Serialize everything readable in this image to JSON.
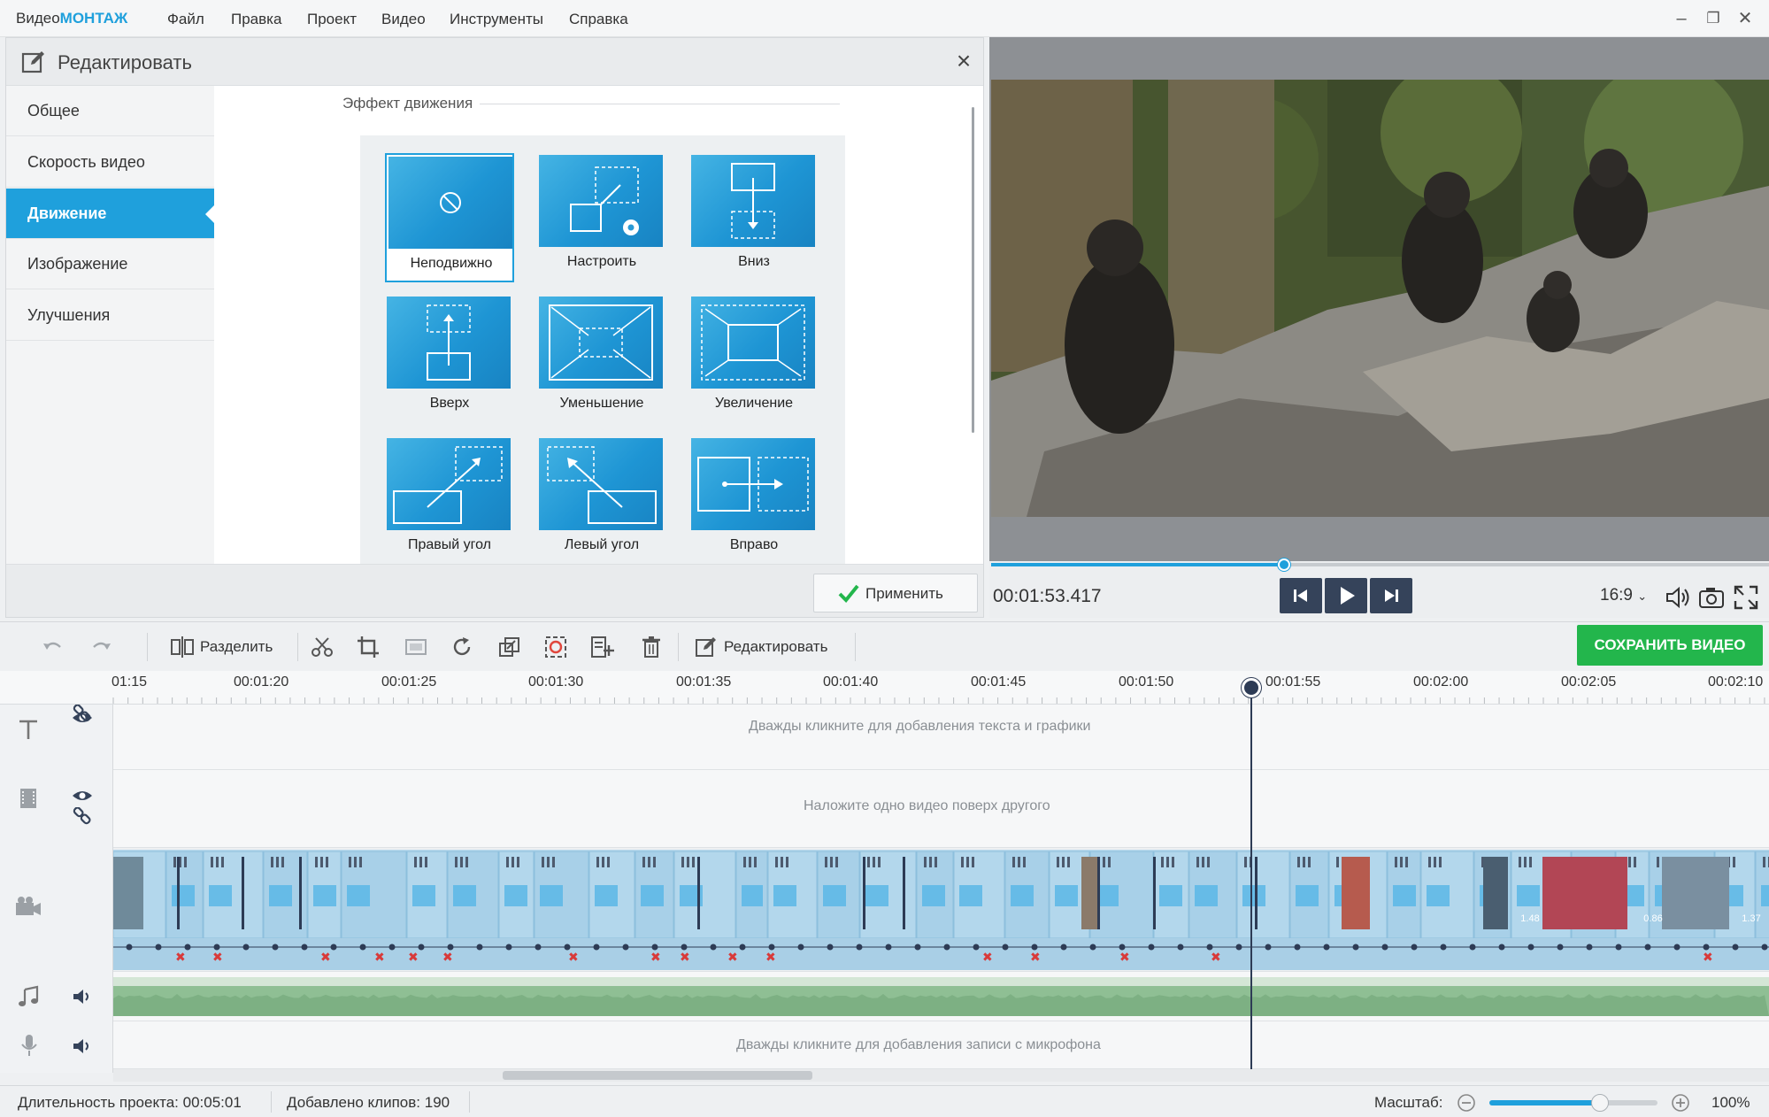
{
  "app": {
    "title_prefix": "Видео",
    "title_accent": "МОНТАЖ"
  },
  "menu": [
    "Файл",
    "Правка",
    "Проект",
    "Видео",
    "Инструменты",
    "Справка"
  ],
  "edit_panel": {
    "title": "Редактировать",
    "nav": [
      "Общее",
      "Скорость видео",
      "Движение",
      "Изображение",
      "Улучшения"
    ],
    "active_nav": "Движение",
    "section_title": "Эффект движения",
    "effects": [
      "Неподвижно",
      "Настроить",
      "Вниз",
      "Вверх",
      "Уменьшение",
      "Увеличение",
      "Правый угол",
      "Левый угол",
      "Вправо"
    ],
    "selected_effect": "Неподвижно",
    "apply_label": "Применить"
  },
  "preview": {
    "timecode": "00:01:53.417",
    "playback_progress": 0.377,
    "aspect_ratio": "16:9"
  },
  "toolbar": {
    "split_label": "Разделить",
    "edit_label": "Редактировать",
    "save_video_label": "СОХРАНИТЬ ВИДЕО"
  },
  "timeline": {
    "ruler_labels": [
      "01:15",
      "00:01:20",
      "00:01:25",
      "00:01:30",
      "00:01:35",
      "00:01:40",
      "00:01:45",
      "00:01:50",
      "00:01:55",
      "00:02:00",
      "00:02:05",
      "00:02:10"
    ],
    "text_track_hint": "Дважды кликните для добавления текста и графики",
    "overlay_track_hint": "Наложите одно видео поверх другого",
    "mic_track_hint": "Дважды кликните для добавления записи с микрофона",
    "clip_durations": [
      "1.48",
      "0.86",
      "1.37"
    ]
  },
  "status": {
    "duration_label": "Длительность проекта:",
    "duration_value": "00:05:01",
    "clips_label": "Добавлено клипов:",
    "clips_value": "190",
    "zoom_label": "Масштаб:",
    "zoom_value": "100%",
    "zoom_slider_level": 0.66
  },
  "colors": {
    "accent": "#1fa0dc",
    "save": "#23b64c",
    "dark": "#35435a"
  }
}
